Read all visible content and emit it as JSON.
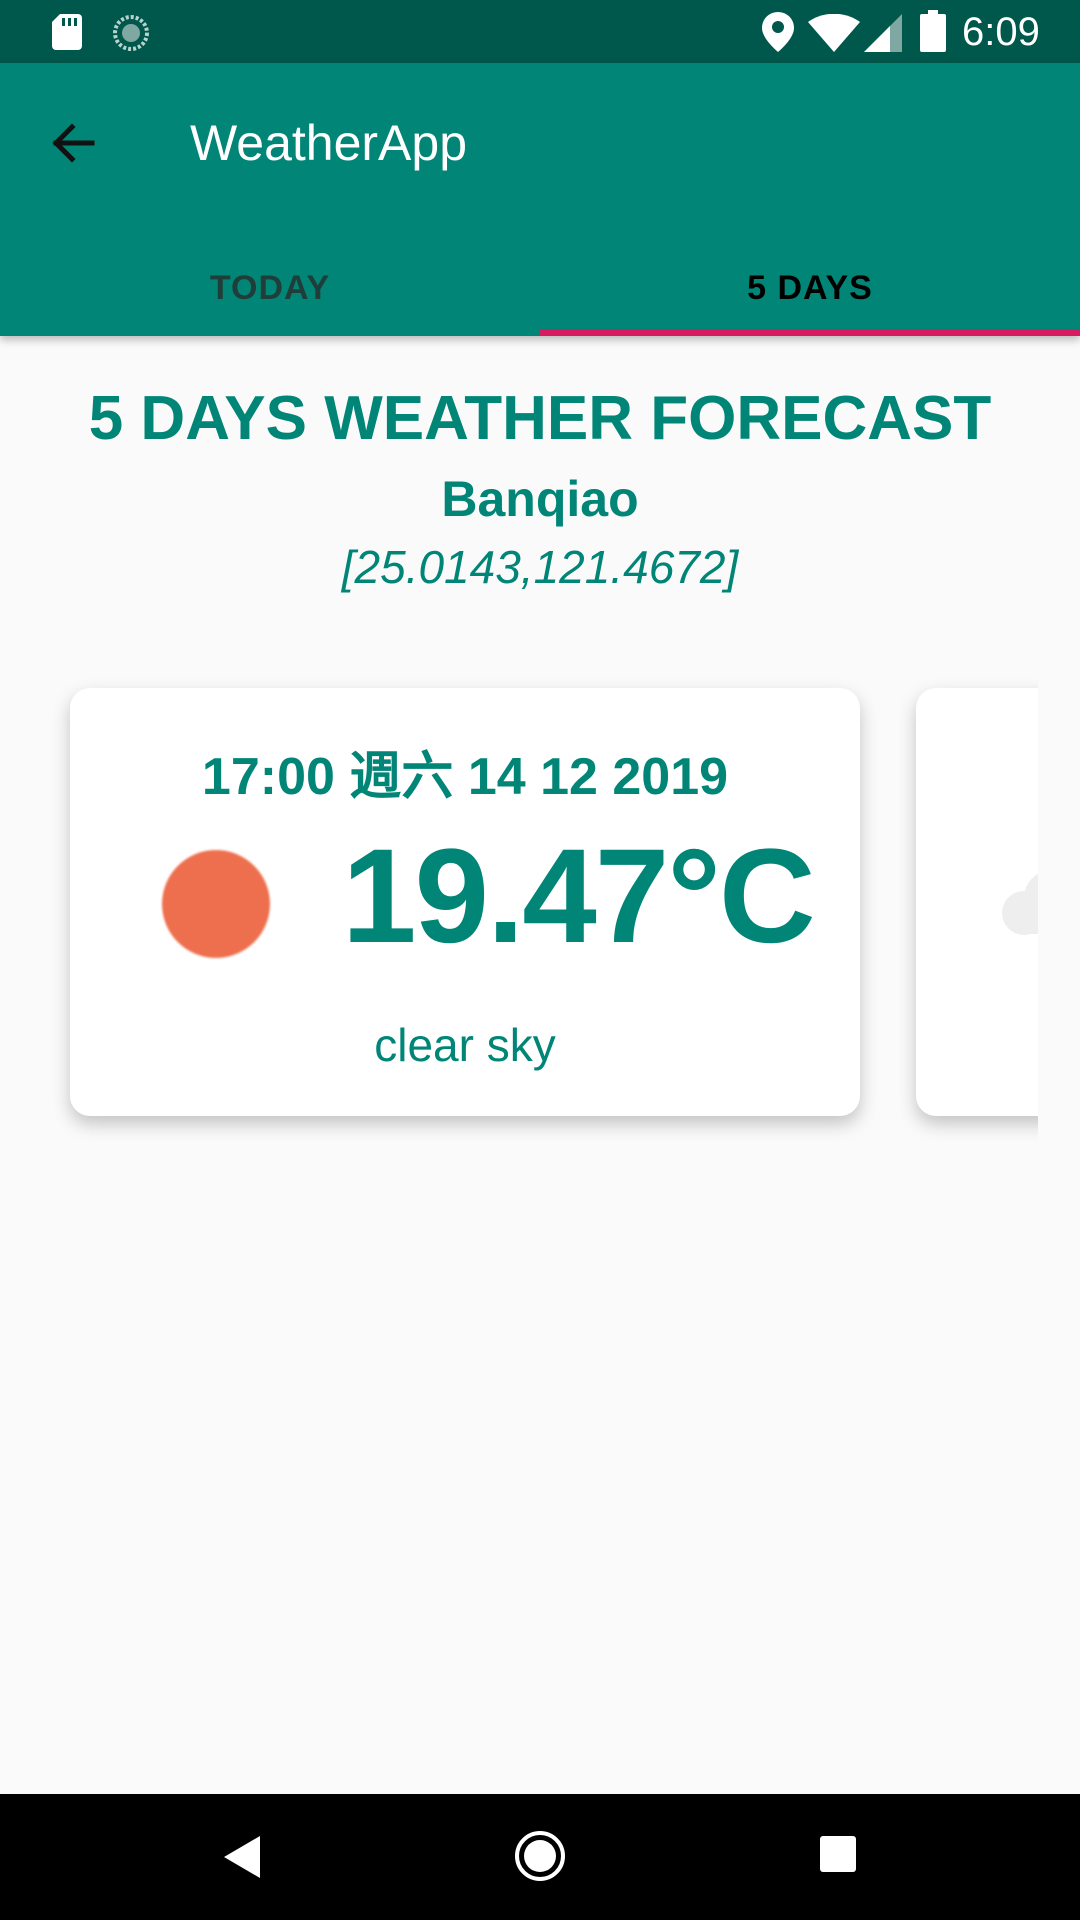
{
  "status_bar": {
    "time": "6:09",
    "icons": [
      "sd-card-icon",
      "sync-icon",
      "location-icon",
      "wifi-icon",
      "signal-icon",
      "battery-icon"
    ]
  },
  "app_bar": {
    "title": "WeatherApp",
    "back_icon": "arrow-left-icon"
  },
  "tabs": [
    {
      "label": "TODAY",
      "selected": false
    },
    {
      "label": "5 DAYS",
      "selected": true
    }
  ],
  "header": {
    "title": "5 DAYS WEATHER FORECAST",
    "city": "Banqiao",
    "coordinates": "[25.0143,121.4672]"
  },
  "forecast_cards": [
    {
      "datetime": "17:00 週六 14 12 2019",
      "temperature": "19.47°C",
      "description": "clear sky",
      "icon": "sun-icon"
    },
    {
      "icon": "cloud-icon"
    }
  ],
  "nav_bar": {
    "icons": [
      "nav-back-icon",
      "nav-home-icon",
      "nav-recents-icon"
    ]
  },
  "colors": {
    "status_bar": "#00574b",
    "primary": "#008577",
    "accent": "#d81b60",
    "sun": "#ee6f4d",
    "background": "#fafafa"
  }
}
